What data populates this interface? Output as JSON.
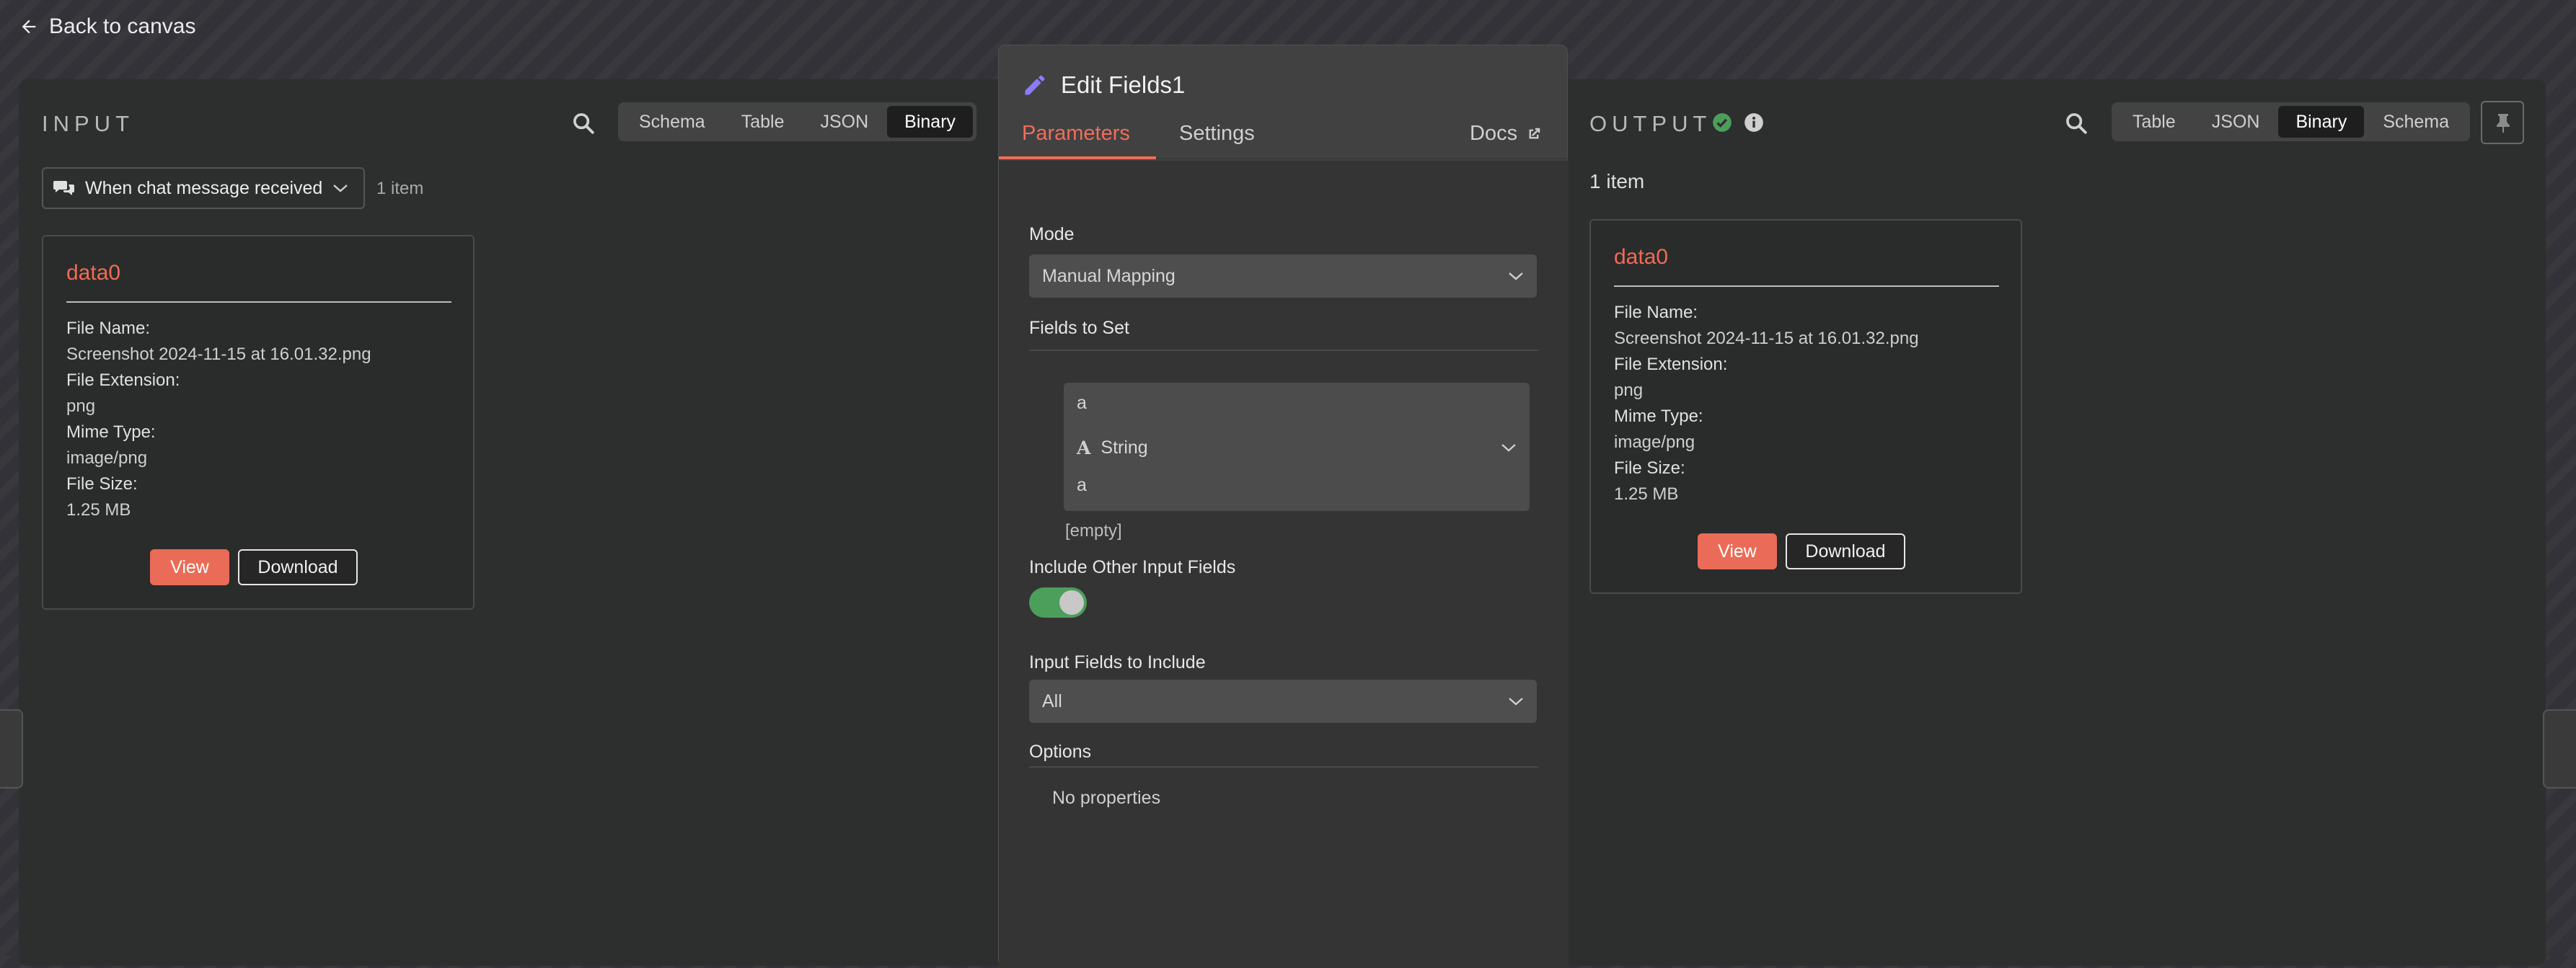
{
  "top": {
    "back_label": "Back to canvas"
  },
  "input": {
    "title": "INPUT",
    "view_tabs": [
      "Schema",
      "Table",
      "JSON",
      "Binary"
    ],
    "active_tab": "Binary",
    "source_select": "When chat message received",
    "item_count": "1 item",
    "card": {
      "name": "data0",
      "fields": [
        {
          "key": "File Name:",
          "value": "Screenshot 2024-11-15 at 16.01.32.png"
        },
        {
          "key": "File Extension:",
          "value": "png"
        },
        {
          "key": "Mime Type:",
          "value": "image/png"
        },
        {
          "key": "File Size:",
          "value": "1.25 MB"
        }
      ],
      "view_label": "View",
      "download_label": "Download"
    }
  },
  "node": {
    "title": "Edit Fields1",
    "tabs": [
      "Parameters",
      "Settings"
    ],
    "docs_label": "Docs",
    "mode_label": "Mode",
    "mode_value": "Manual Mapping",
    "fields_to_set_label": "Fields to Set",
    "field": {
      "name": "a",
      "type": "String",
      "value": "a",
      "preview": "[empty]"
    },
    "include_other_label": "Include Other Input Fields",
    "include_other_on": true,
    "input_fields_label": "Input Fields to Include",
    "input_fields_value": "All",
    "options_label": "Options",
    "no_properties": "No properties"
  },
  "output": {
    "title": "OUTPUT",
    "view_tabs": [
      "Table",
      "JSON",
      "Binary",
      "Schema"
    ],
    "active_tab": "Binary",
    "item_count": "1 item",
    "card": {
      "name": "data0",
      "fields": [
        {
          "key": "File Name:",
          "value": "Screenshot 2024-11-15 at 16.01.32.png"
        },
        {
          "key": "File Extension:",
          "value": "png"
        },
        {
          "key": "Mime Type:",
          "value": "image/png"
        },
        {
          "key": "File Size:",
          "value": "1.25 MB"
        }
      ],
      "view_label": "View",
      "download_label": "Download"
    }
  },
  "colors": {
    "accent": "#ef6e5a",
    "success": "#4c9e5b",
    "panel": "#2d2e2e",
    "node_icon": "#8b7cf6"
  },
  "icons": [
    "arrow-left-icon",
    "search-icon",
    "chat-icon",
    "chevron-down-icon",
    "pencil-icon",
    "external-link-icon",
    "string-type-icon",
    "check-circle-icon",
    "info-icon",
    "pin-icon"
  ]
}
